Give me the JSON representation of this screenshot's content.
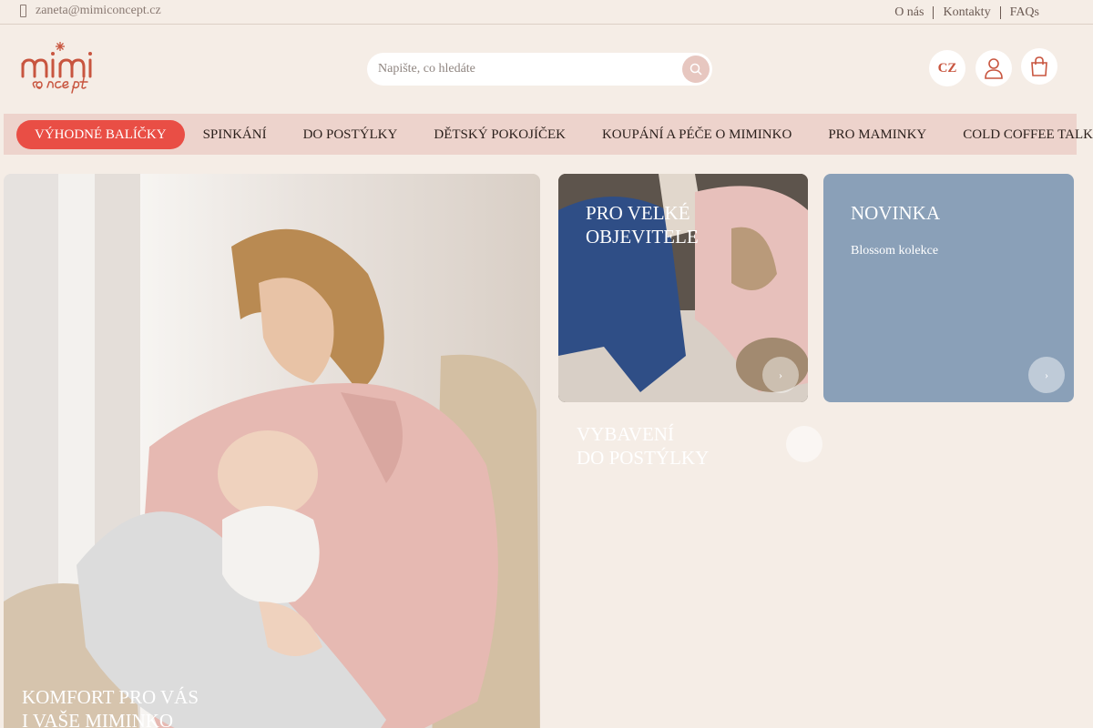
{
  "topbar": {
    "email": "zaneta@mimiconcept.cz",
    "links": [
      "O nás",
      "Kontakty",
      "FAQs"
    ]
  },
  "header": {
    "logo_icon": "mimi-concept-logo",
    "search_placeholder": "Napište, co hledáte",
    "language": "CZ"
  },
  "nav": {
    "items": [
      "VÝHODNÉ BALÍČKY",
      "SPINKÁNÍ",
      "DO POSTÝLKY",
      "DĚTSKÝ POKOJÍČEK",
      "KOUPÁNÍ A PÉČE O MIMINKO",
      "PRO MAMINKY",
      "COLD COFFEE TALKS"
    ]
  },
  "tiles": {
    "hero": {
      "title_line1": "KOMFORT PRO VÁS",
      "title_line2": "I VAŠE MIMINKO"
    },
    "kids": {
      "title_line1": "PRO VELKÉ",
      "title_line2": "OBJEVITELE"
    },
    "new": {
      "title": "NOVINKA",
      "subtitle": "Blossom kolekce"
    },
    "bed": {
      "title_line1": "VYBAVENÍ",
      "title_line2": "DO POSTÝLKY"
    }
  },
  "colors": {
    "background": "#f5ede6",
    "nav_bg": "#edd3cc",
    "accent": "#e94e45",
    "brand": "#c8553f",
    "novinka_bg": "#8aa0b8"
  }
}
